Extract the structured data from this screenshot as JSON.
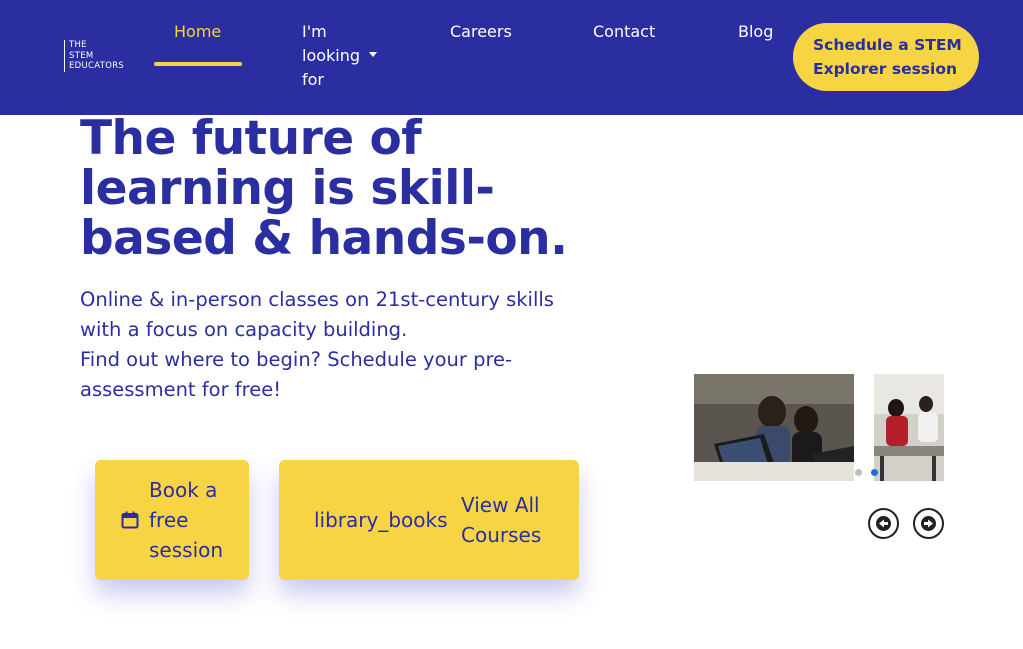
{
  "brand": {
    "logo_lines": [
      "THE",
      "STEM",
      "EDUCATORS"
    ]
  },
  "nav": {
    "items": [
      {
        "label": "Home",
        "active": true
      },
      {
        "label": "I'm looking for"
      },
      {
        "label": "Careers"
      },
      {
        "label": "Contact"
      },
      {
        "label": "Blog"
      }
    ],
    "cta_label": "Schedule a STEM Explorer session"
  },
  "hero": {
    "headline": "The future of learning is skill-based & hands-on.",
    "subtext_line1": "Online & in-person classes on 21st-century skills with a focus on capacity building.",
    "subtext_line2": "Find out where to begin? Schedule your pre-assessment for free!"
  },
  "buttons": {
    "book_label": "Book a free session",
    "book_icon": "calendar-icon",
    "courses_icon_text": "library_books",
    "courses_label": "View All Courses"
  },
  "carousel": {
    "slides": [
      {
        "alt": "students at laptops"
      },
      {
        "alt": "kids working at desk"
      }
    ],
    "active_dot": 2,
    "dot_count": 2
  },
  "colors": {
    "brand_blue": "#2a2ea0",
    "accent_yellow": "#f7d443",
    "dot_active": "#1b6fd8"
  }
}
